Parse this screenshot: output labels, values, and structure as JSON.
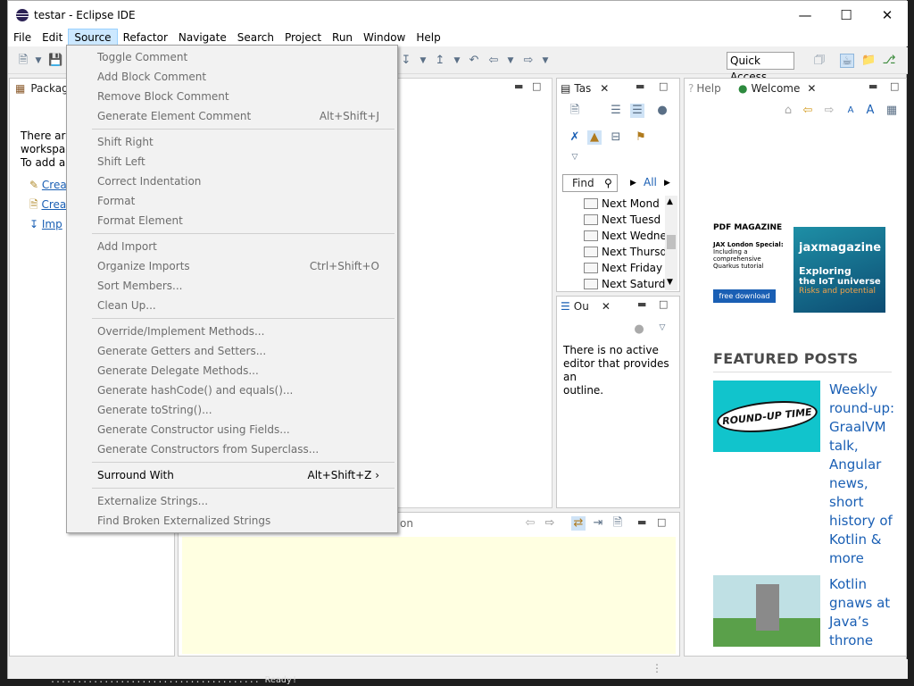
{
  "window": {
    "title": "testar - Eclipse IDE"
  },
  "menubar": [
    "File",
    "Edit",
    "Source",
    "Refactor",
    "Navigate",
    "Search",
    "Project",
    "Run",
    "Window",
    "Help"
  ],
  "toolbar": {
    "quick_access": "Quick Access"
  },
  "package_explorer": {
    "tab": "Packag",
    "text_lines": [
      "There are",
      "workspace",
      "To add a p"
    ],
    "links": [
      "Crea",
      "Crea",
      "Imp"
    ]
  },
  "tasks": {
    "tab": "Tas",
    "find_placeholder": "Find",
    "all_label": "All",
    "rows": [
      "Next Mond",
      "Next Tuesd",
      "Next Wedne",
      "Next Thursd",
      "Next Friday",
      "Next Saturd"
    ]
  },
  "outline": {
    "tab": "Ou",
    "message": [
      "There is no active",
      "editor that provides an",
      "outline."
    ]
  },
  "bottom_panel": {
    "tab_fragment": "on"
  },
  "welcome": {
    "help_tab": "Help",
    "welcome_tab": "Welcome",
    "ad": {
      "heading": "PDF MAGAZINE",
      "l1": "JAX London Special:",
      "l2": "Including a",
      "l3": "comprehensive",
      "l4": "Quarkus tutorial",
      "button": "free download",
      "brand": "jaxmagazine",
      "t1": "Exploring",
      "t2": "the IoT universe",
      "t3": "Risks and potential"
    },
    "featured": "FEATURED POSTS",
    "posts": [
      {
        "title": [
          "Weekly",
          "round-up:",
          "GraalVM",
          "talk,",
          "Angular",
          "news,",
          "short",
          "history of",
          "Kotlin &",
          "more"
        ],
        "image_text": "ROUND-UP TIME"
      },
      {
        "title": [
          "Kotlin",
          "gnaws at",
          "Java’s",
          "throne"
        ]
      }
    ]
  },
  "source_menu": {
    "items": [
      {
        "label": "Toggle Comment",
        "shortcut": "",
        "enabled": false
      },
      {
        "label": "Add Block Comment",
        "shortcut": "",
        "enabled": false
      },
      {
        "label": "Remove Block Comment",
        "shortcut": "",
        "enabled": false
      },
      {
        "label": "Generate Element Comment",
        "shortcut": "Alt+Shift+J",
        "enabled": false
      },
      {
        "label": "Shift Right",
        "shortcut": "",
        "enabled": false
      },
      {
        "label": "Shift Left",
        "shortcut": "",
        "enabled": false
      },
      {
        "label": "Correct Indentation",
        "shortcut": "",
        "enabled": false
      },
      {
        "label": "Format",
        "shortcut": "",
        "enabled": false
      },
      {
        "label": "Format Element",
        "shortcut": "",
        "enabled": false
      },
      {
        "label": "Add Import",
        "shortcut": "",
        "enabled": false
      },
      {
        "label": "Organize Imports",
        "shortcut": "Ctrl+Shift+O",
        "enabled": false
      },
      {
        "label": "Sort Members...",
        "shortcut": "",
        "enabled": false
      },
      {
        "label": "Clean Up...",
        "shortcut": "",
        "enabled": false
      },
      {
        "label": "Override/Implement Methods...",
        "shortcut": "",
        "enabled": false
      },
      {
        "label": "Generate Getters and Setters...",
        "shortcut": "",
        "enabled": false
      },
      {
        "label": "Generate Delegate Methods...",
        "shortcut": "",
        "enabled": false
      },
      {
        "label": "Generate hashCode() and equals()...",
        "shortcut": "",
        "enabled": false
      },
      {
        "label": "Generate toString()...",
        "shortcut": "",
        "enabled": false
      },
      {
        "label": "Generate Constructor using Fields...",
        "shortcut": "",
        "enabled": false
      },
      {
        "label": "Generate Constructors from Superclass...",
        "shortcut": "",
        "enabled": false
      },
      {
        "label": "Surround With",
        "shortcut": "Alt+Shift+Z",
        "enabled": true
      },
      {
        "label": "Externalize Strings...",
        "shortcut": "",
        "enabled": false
      },
      {
        "label": "Find Broken Externalized Strings",
        "shortcut": "",
        "enabled": false
      }
    ]
  },
  "background_console": {
    "text": "Ready!"
  }
}
